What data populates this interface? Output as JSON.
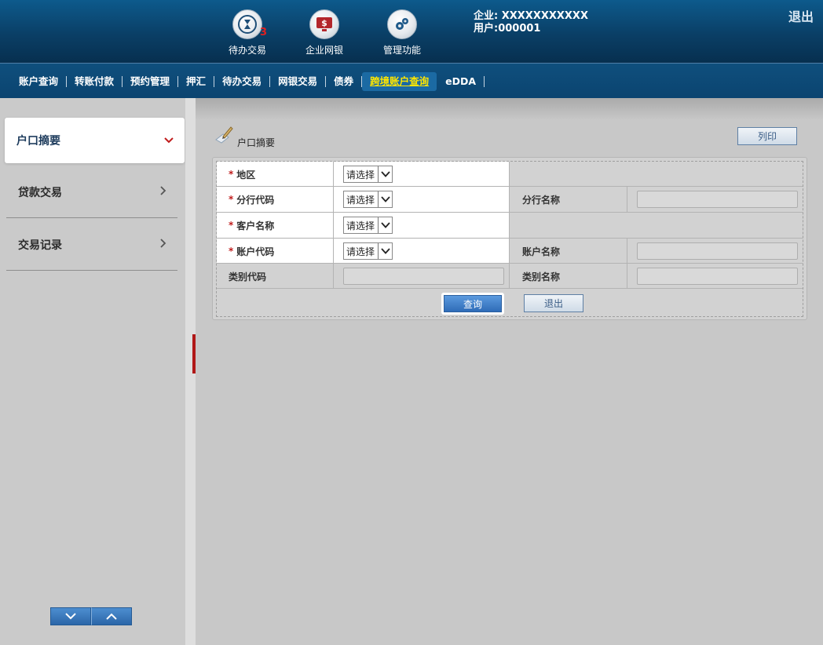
{
  "header": {
    "icons": [
      {
        "label": "待办交易",
        "badge": "3",
        "icon": "hourglass-icon"
      },
      {
        "label": "企业网银",
        "icon": "monitor-dollar-icon"
      },
      {
        "label": "管理功能",
        "icon": "gears-icon"
      }
    ],
    "company": "企业: XXXXXXXXXXX",
    "user": "用户:000001",
    "logout": "退出"
  },
  "nav": {
    "items": [
      "账户查询",
      "转账付款",
      "预约管理",
      "押汇",
      "待办交易",
      "网银交易",
      "债券",
      "跨境账户查询",
      "eDDA"
    ],
    "active_index": 7
  },
  "sidebar": {
    "items": [
      {
        "label": "户口摘要",
        "active": true
      },
      {
        "label": "贷款交易",
        "active": false
      },
      {
        "label": "交易记录",
        "active": false
      }
    ]
  },
  "main": {
    "section_title": "户口摘要",
    "print_label": "列印",
    "form": {
      "region_label": "地区",
      "branch_code_label": "分行代码",
      "branch_name_label": "分行名称",
      "customer_name_label": "客户名称",
      "account_code_label": "账户代码",
      "account_name_label": "账户名称",
      "category_code_label": "类别代码",
      "category_name_label": "类别名称",
      "select_placeholder": "请选择",
      "required_mark": "*"
    },
    "query_label": "查询",
    "exit_label": "退出"
  },
  "colors": {
    "header_bg": "#0a3f66",
    "nav_active_text": "#ffe600",
    "required": "#c01c1c",
    "collapse_tab": "#b01818"
  }
}
